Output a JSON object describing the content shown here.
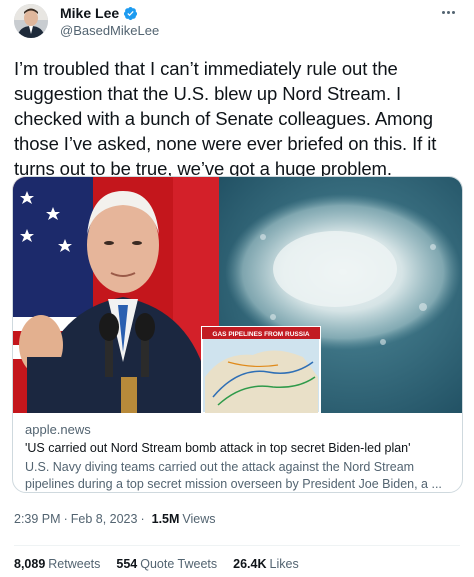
{
  "author": {
    "name": "Mike Lee",
    "handle": "@BasedMikeLee",
    "verified_color": "#1d9bf0"
  },
  "tweet": {
    "text": "I’m troubled that I can’t immediately rule out the suggestion that the U.S. blew up Nord Stream. I checked with a bunch of Senate colleagues. Among those I’ve asked, none were ever briefed on this. If it turns out to be true, we’ve got a huge problem."
  },
  "card": {
    "domain": "apple.news",
    "title": "'US carried out Nord Stream bomb attack in top secret Biden-led plan'",
    "description": "U.S. Navy diving teams carried out the attack against the Nord Stream pipelines during a top secret mission overseen by President Joe Biden, a ...",
    "inset_caption": "GAS PIPELINES FROM RUSSIA"
  },
  "meta": {
    "time": "2:39 PM",
    "date": "Feb 8, 2023",
    "separator": "·",
    "views_count": "1.5M",
    "views_label": "Views"
  },
  "stats": {
    "retweets_count": "8,089",
    "retweets_label": "Retweets",
    "quotes_count": "554",
    "quotes_label": "Quote Tweets",
    "likes_count": "26.4K",
    "likes_label": "Likes"
  },
  "colors": {
    "text_primary": "#0f1419",
    "text_secondary": "#536471",
    "border": "#cfd9de",
    "accent": "#1d9bf0"
  },
  "icons": {
    "verified": "verified-badge-icon",
    "more": "more-options-icon"
  }
}
